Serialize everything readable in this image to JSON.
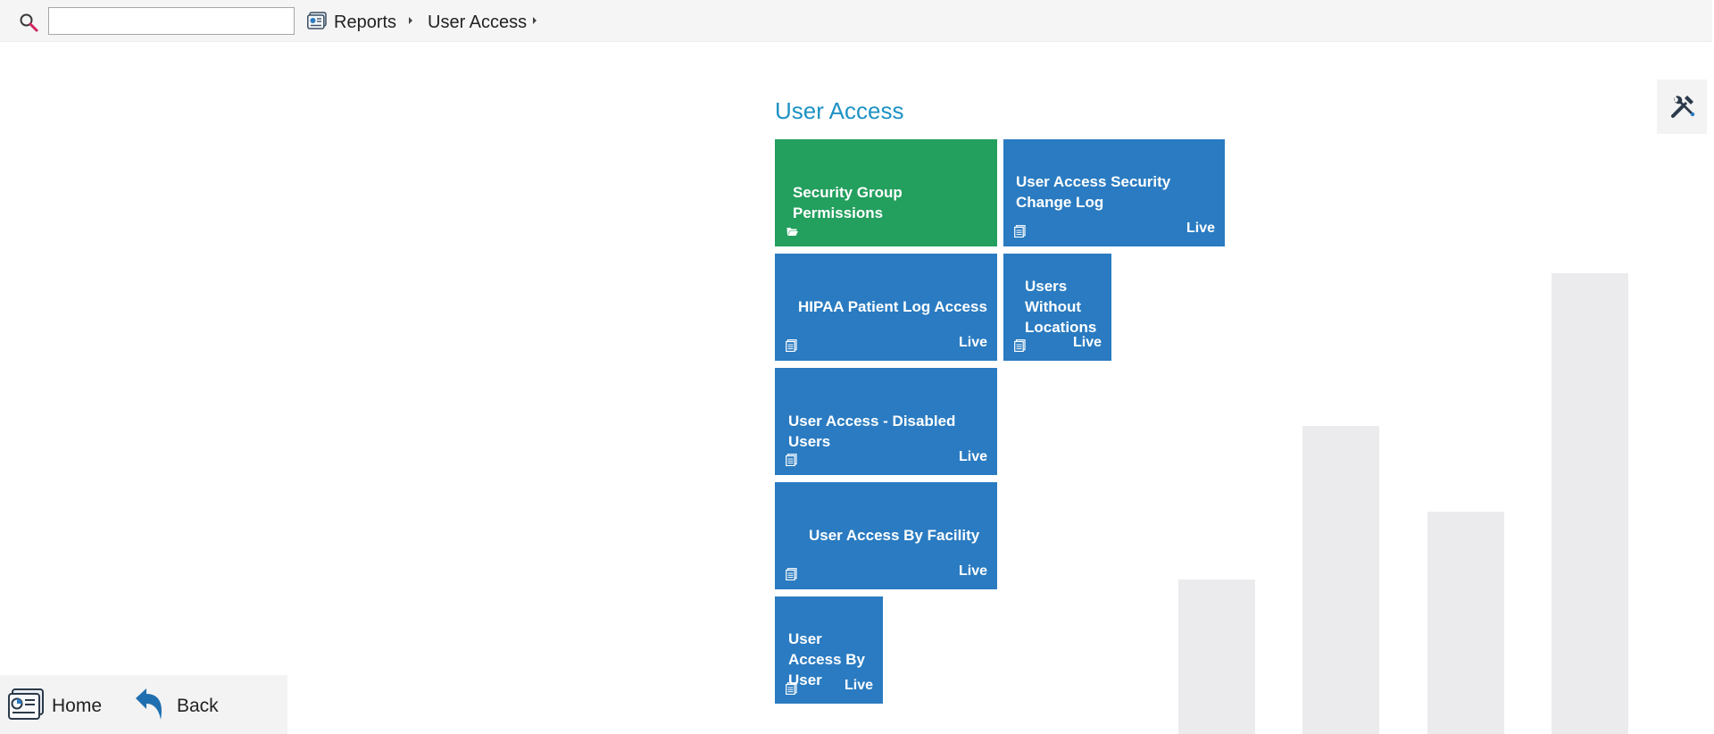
{
  "header": {
    "search": {
      "value": "",
      "placeholder": ""
    },
    "breadcrumb": [
      "Reports",
      "User Access"
    ]
  },
  "section": {
    "title": "User Access"
  },
  "tiles": [
    {
      "label": "Security Group Permissions",
      "badge": "",
      "icon": "folder-open-icon",
      "color": "#239f5e"
    },
    {
      "label": "User Access Security Change Log",
      "badge": "Live",
      "icon": "report-icon",
      "color": "#2a7bc1"
    },
    {
      "label": "HIPAA Patient Log Access",
      "badge": "Live",
      "icon": "report-icon",
      "color": "#2a7bc1"
    },
    {
      "label": "Users Without Locations",
      "badge": "Live",
      "icon": "report-icon",
      "color": "#2a7bc1"
    },
    {
      "label": "User Access - Disabled Users",
      "badge": "Live",
      "icon": "report-icon",
      "color": "#2a7bc1"
    },
    {
      "label": "User Access By Facility",
      "badge": "Live",
      "icon": "report-icon",
      "color": "#2a7bc1"
    },
    {
      "label": "User Access By User",
      "badge": "Live",
      "icon": "report-icon",
      "color": "#2a7bc1"
    }
  ],
  "footer": {
    "home_label": "Home",
    "back_label": "Back"
  },
  "colors": {
    "title": "#1e92c4",
    "tile_blue": "#2a7bc1",
    "tile_green": "#239f5e",
    "background_bars": "#ebebed"
  },
  "icons": [
    "search-icon",
    "reports-icon",
    "tools-icon",
    "folder-open-icon",
    "report-icon",
    "home-icon",
    "back-arrow-icon"
  ]
}
